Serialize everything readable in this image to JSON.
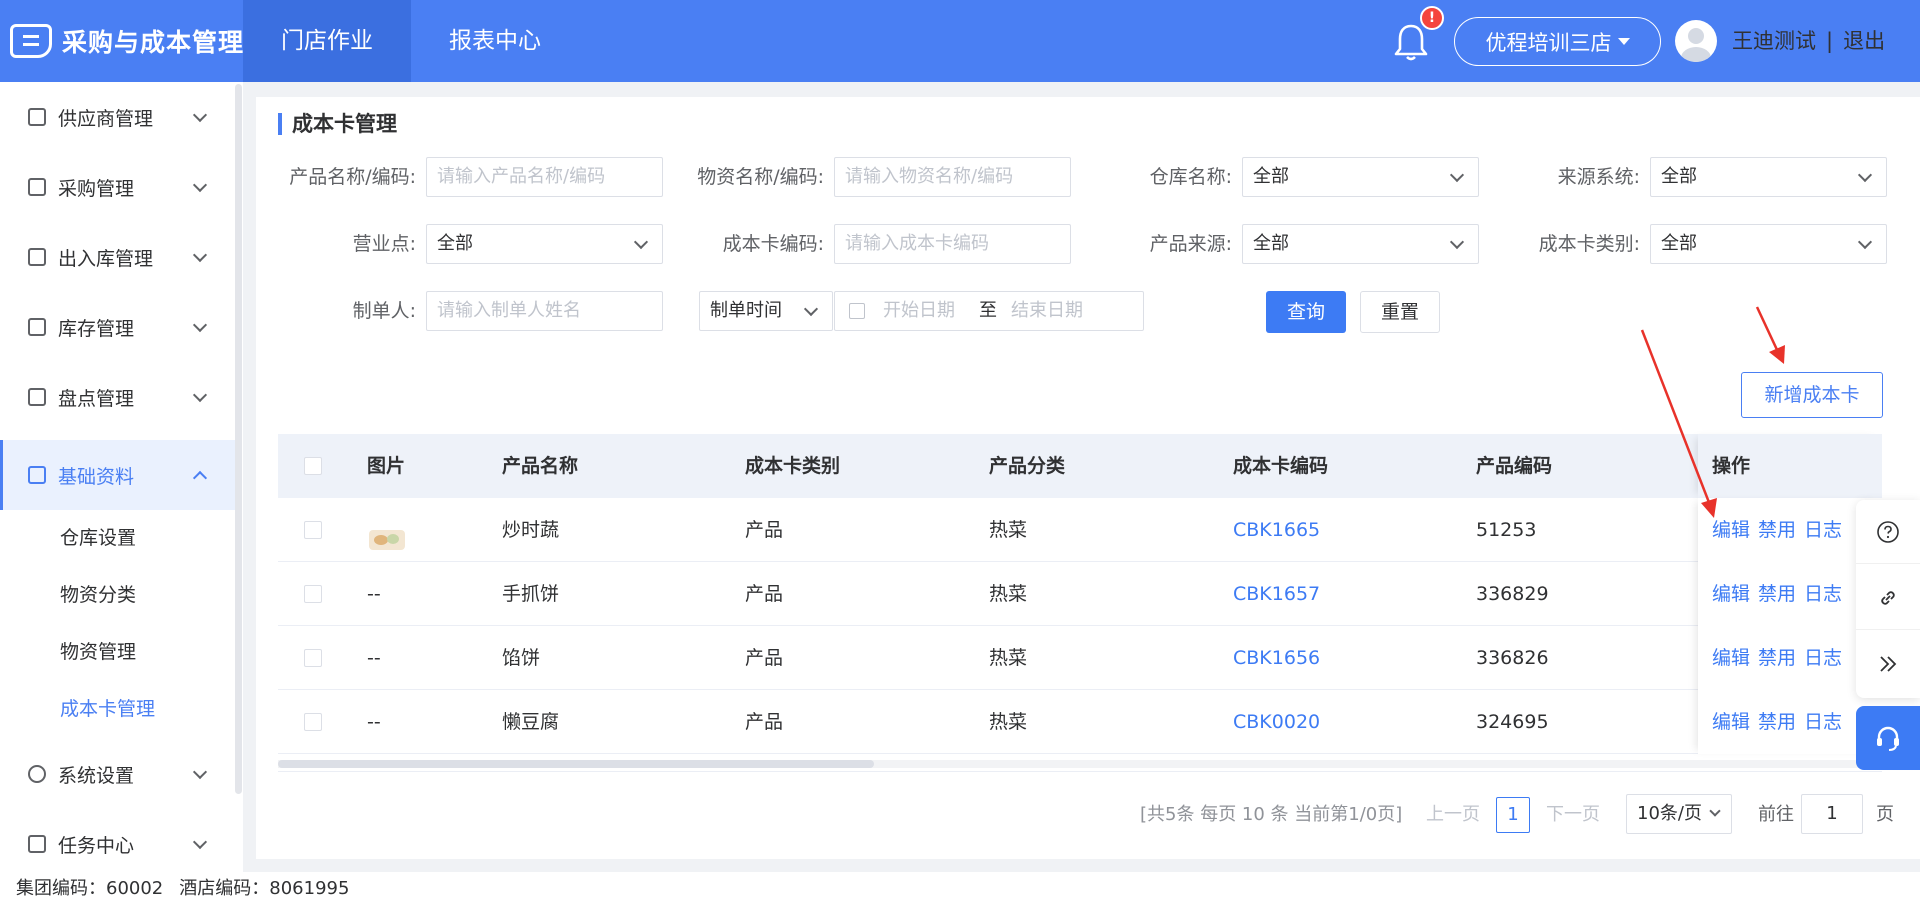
{
  "app": {
    "title": "采购与成本管理"
  },
  "topnav": [
    {
      "label": "门店作业",
      "active": true
    },
    {
      "label": "报表中心",
      "active": false
    }
  ],
  "header": {
    "notification_badge": "!",
    "store": "优程培训三店",
    "user": "王迪测试",
    "separator": "|",
    "logout": "退出"
  },
  "sidebar": {
    "items": [
      {
        "label": "供应商管理",
        "icon": "handshake-icon"
      },
      {
        "label": "采购管理",
        "icon": "bag-icon"
      },
      {
        "label": "出入库管理",
        "icon": "door-icon"
      },
      {
        "label": "库存管理",
        "icon": "box-icon"
      },
      {
        "label": "盘点管理",
        "icon": "doc-search-icon"
      },
      {
        "label": "基础资料",
        "icon": "chart-icon",
        "open": true
      },
      {
        "label": "系统设置",
        "icon": "gear-icon"
      },
      {
        "label": "任务中心",
        "icon": "list-icon"
      }
    ],
    "sub_items": [
      {
        "label": "仓库设置"
      },
      {
        "label": "物资分类"
      },
      {
        "label": "物资管理"
      },
      {
        "label": "成本卡管理",
        "active": true
      }
    ]
  },
  "footer": {
    "group_code": "集团编码：60002",
    "hotel_code": "酒店编码：8061995"
  },
  "page": {
    "title": "成本卡管理"
  },
  "filters": {
    "product_label": "产品名称/编码:",
    "product_placeholder": "请输入产品名称/编码",
    "material_label": "物资名称/编码:",
    "material_placeholder": "请输入物资名称/编码",
    "warehouse_label": "仓库名称:",
    "warehouse_value": "全部",
    "source_system_label": "来源系统:",
    "source_system_value": "全部",
    "outlet_label": "营业点:",
    "outlet_value": "全部",
    "costcard_code_label": "成本卡编码:",
    "costcard_code_placeholder": "请输入成本卡编码",
    "product_source_label": "产品来源:",
    "product_source_value": "全部",
    "costcard_type_label": "成本卡类别:",
    "costcard_type_value": "全部",
    "maker_label": "制单人:",
    "maker_placeholder": "请输入制单人姓名",
    "time_type_value": "制单时间",
    "start_placeholder": "开始日期",
    "range_to": "至",
    "end_placeholder": "结束日期",
    "query_button": "查询",
    "reset_button": "重置"
  },
  "actions": {
    "add_button": "新增成本卡"
  },
  "table": {
    "columns": [
      "图片",
      "产品名称",
      "成本卡类别",
      "产品分类",
      "成本卡编码",
      "产品编码",
      "操作"
    ],
    "rows": [
      {
        "image": "",
        "has_image": true,
        "name": "炒时蔬",
        "type": "产品",
        "category": "热菜",
        "code": "CBK1665",
        "product_code": "51253"
      },
      {
        "image": "--",
        "has_image": false,
        "name": "手抓饼",
        "type": "产品",
        "category": "热菜",
        "code": "CBK1657",
        "product_code": "336829"
      },
      {
        "image": "--",
        "has_image": false,
        "name": "馅饼",
        "type": "产品",
        "category": "热菜",
        "code": "CBK1656",
        "product_code": "336826"
      },
      {
        "image": "--",
        "has_image": false,
        "name": "懒豆腐",
        "type": "产品",
        "category": "热菜",
        "code": "CBK0020",
        "product_code": "324695"
      }
    ],
    "op_edit": "编辑",
    "op_disable": "禁用",
    "op_log": "日志"
  },
  "pagination": {
    "info": "[共5条 每页 10 条 当前第1/0页]",
    "prev": "上一页",
    "current": "1",
    "next": "下一页",
    "page_size": "10条/页",
    "goto_label": "前往",
    "goto_value": "1",
    "goto_suffix": "页"
  },
  "colors": {
    "primary": "#4a7ff3",
    "link": "#3d7bf4",
    "badge": "#f5453d",
    "annotation": "#e8322a"
  }
}
